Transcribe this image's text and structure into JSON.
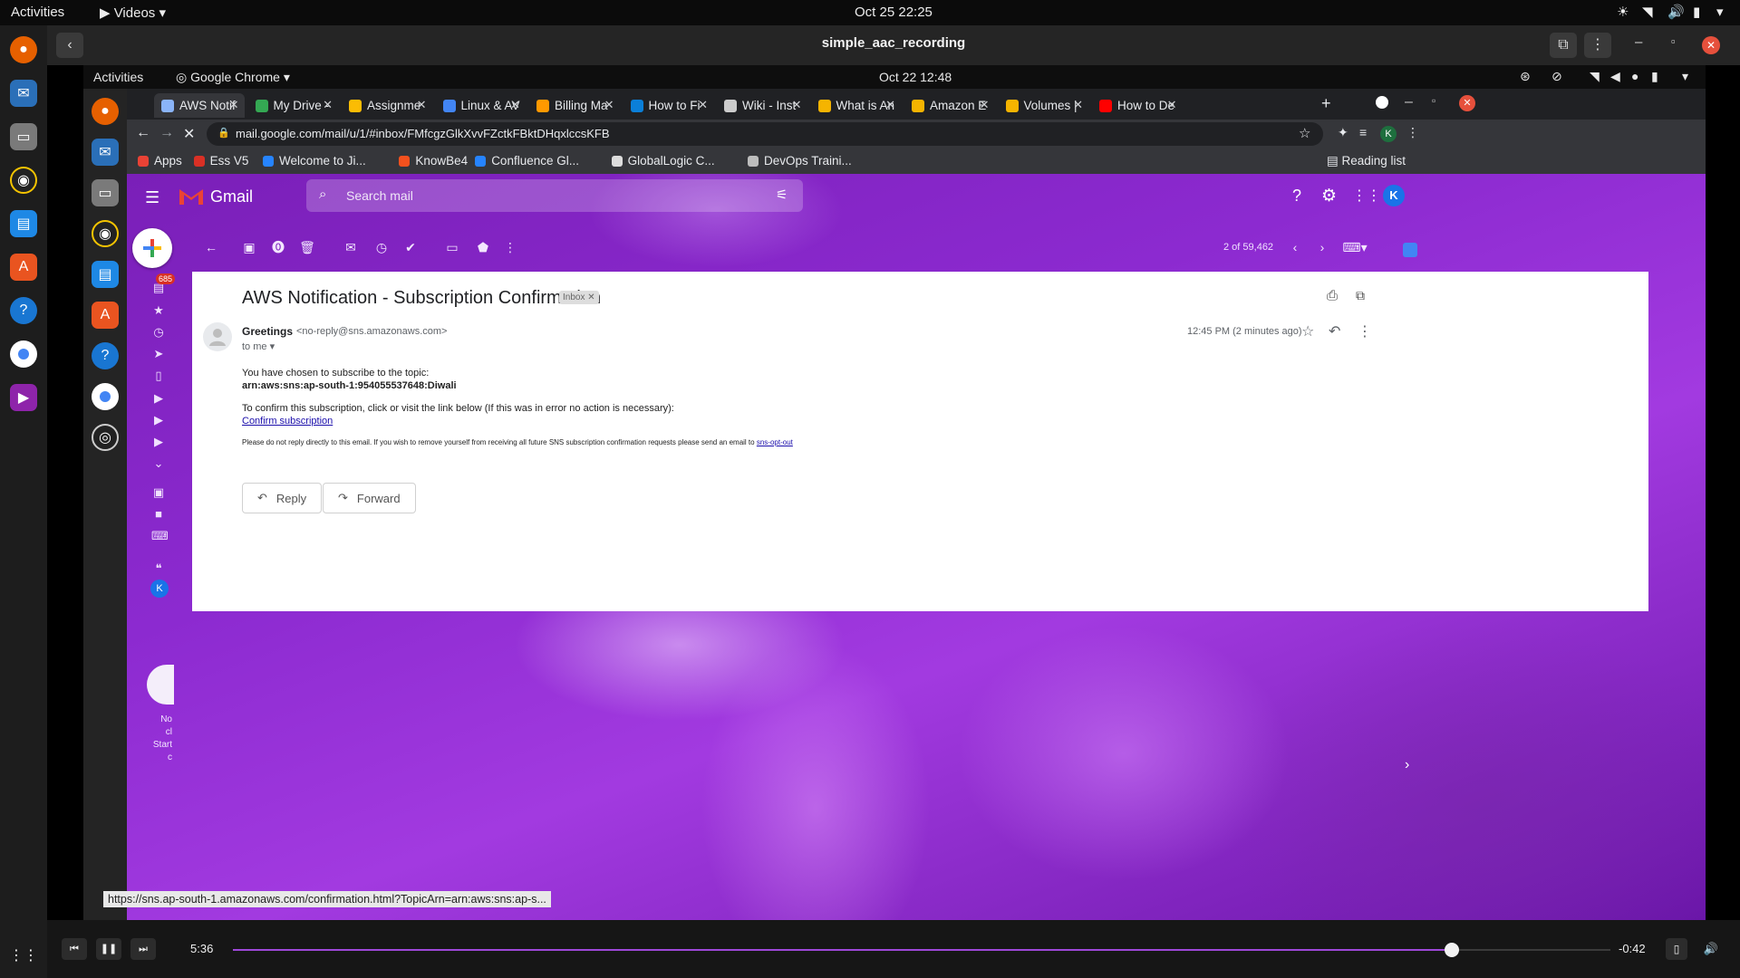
{
  "os_topbar": {
    "activities": "Activities",
    "app_menu": "Videos",
    "datetime": "Oct 25  22:25"
  },
  "player": {
    "title": "simple_aac_recording",
    "current_time": "5:36",
    "remaining_time": "-0:42",
    "progress_fraction": 0.885
  },
  "inner_topbar": {
    "activities": "Activities",
    "app_menu": "Google Chrome",
    "datetime": "Oct 22  12:48"
  },
  "browser": {
    "tabs": [
      {
        "label": "AWS Notif",
        "color": "#8ab4f8",
        "active": true
      },
      {
        "label": "My Drive -",
        "color": "#34a853"
      },
      {
        "label": "Assignme",
        "color": "#fbbc04"
      },
      {
        "label": "Linux & AV",
        "color": "#4285f4"
      },
      {
        "label": "Billing Ma",
        "color": "#ff9900"
      },
      {
        "label": "How to Fi",
        "color": "#0b7fd8"
      },
      {
        "label": "Wiki - Inst",
        "color": "#cccccc"
      },
      {
        "label": "What is An",
        "color": "#f5b400"
      },
      {
        "label": "Amazon E",
        "color": "#f5b400"
      },
      {
        "label": "Volumes |",
        "color": "#f5b400"
      },
      {
        "label": "How to De",
        "color": "#ff0000"
      }
    ],
    "url": "mail.google.com/mail/u/1/#inbox/FMfcgzGlkXvvFZctkFBktDHqxlccsKFB",
    "bookmarks": [
      {
        "label": "Apps",
        "color": "#e94235"
      },
      {
        "label": "Ess V5",
        "color": "#d93025"
      },
      {
        "label": "Welcome to Ji...",
        "color": "#2684ff"
      },
      {
        "label": "KnowBe4",
        "color": "#f4511e"
      },
      {
        "label": "Confluence Gl...",
        "color": "#2684ff"
      },
      {
        "label": "GlobalLogic C...",
        "color": "#dddddd"
      },
      {
        "label": "DevOps Traini...",
        "color": "#bdbdbd"
      }
    ],
    "reading_list": "Reading list",
    "status_url": "https://sns.ap-south-1.amazonaws.com/confirmation.html?TopicArn=arn:aws:sns:ap-s..."
  },
  "gmail": {
    "logo_text": "Gmail",
    "search_placeholder": "Search mail",
    "account_initial": "K",
    "pagination": "2 of 59,462",
    "unread_badge": "685",
    "side_initial": "K",
    "side_text": [
      "No",
      "cl",
      "Start",
      "c"
    ],
    "email": {
      "subject": "AWS Notification - Subscription Confirmation",
      "label": "Inbox",
      "sender_name": "Greetings",
      "sender_email": "<no-reply@sns.amazonaws.com>",
      "to": "to me",
      "time": "12:45 PM (2 minutes ago)",
      "body_line1": "You have chosen to subscribe to the topic:",
      "topic_arn": "arn:aws:sns:ap-south-1:954055537648:Diwali",
      "body_line2": "To confirm this subscription, click or visit the link below (If this was in error no action is necessary):",
      "confirm_link": "Confirm subscription",
      "footer_text": "Please do not reply directly to this email. If you wish to remove yourself from receiving all future SNS subscription confirmation requests please send an email to",
      "footer_link": "sns-opt-out",
      "reply_label": "Reply",
      "forward_label": "Forward"
    }
  }
}
